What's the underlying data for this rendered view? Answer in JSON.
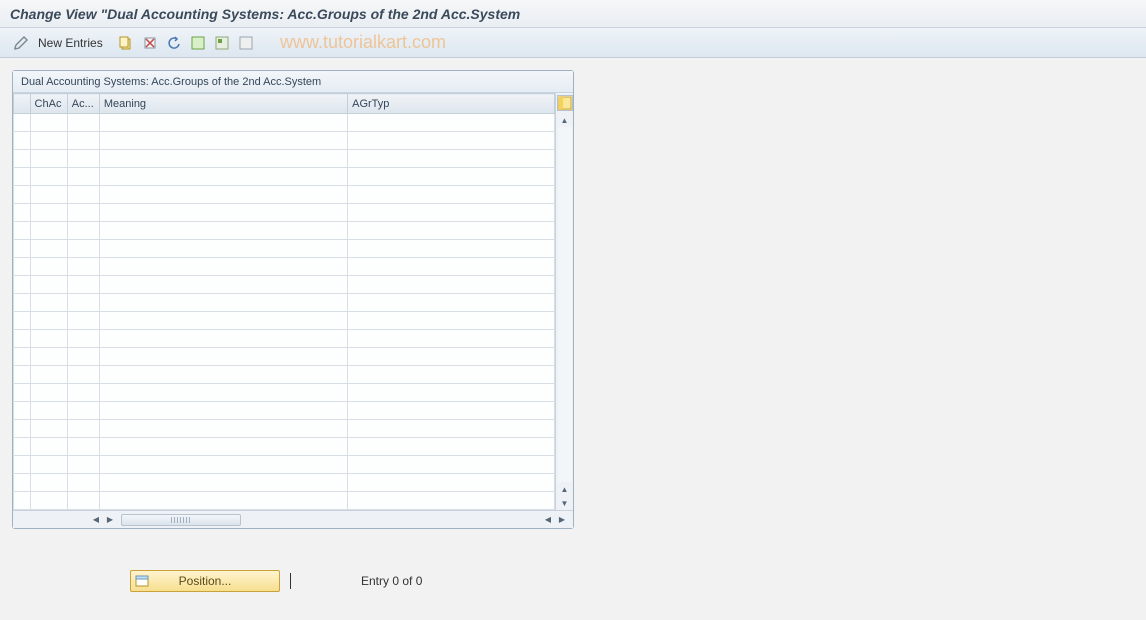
{
  "title": "Change View \"Dual Accounting Systems: Acc.Groups of the 2nd Acc.System",
  "toolbar": {
    "new_entries_label": "New Entries"
  },
  "watermark": "www.tutorialkart.com",
  "grid": {
    "title": "Dual Accounting Systems: Acc.Groups of the 2nd Acc.System",
    "columns": {
      "chac": "ChAc",
      "ac": "Ac...",
      "meaning": "Meaning",
      "agrtyp": "AGrTyp"
    },
    "row_count": 22
  },
  "footer": {
    "position_button": "Position...",
    "entry_text": "Entry 0 of 0"
  }
}
